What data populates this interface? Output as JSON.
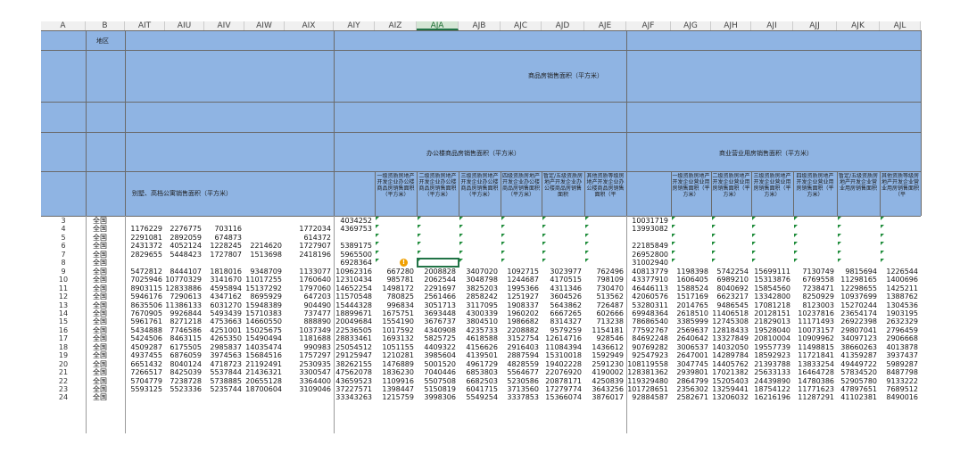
{
  "columns": [
    "A",
    "B",
    "AIT",
    "AIU",
    "AIV",
    "AIW",
    "AIX",
    "AIY",
    "AIZ",
    "AJA",
    "AJB",
    "AJC",
    "AJD",
    "AJE",
    "AJF",
    "AJG",
    "AJH",
    "AJI",
    "AJJ",
    "AJK",
    "AJL"
  ],
  "selected_column": "AJA",
  "row_labels": {
    "r1": "地区",
    "r2": "商品房销售面积（平方米）",
    "r_office": "办公楼商品房销售面积（平方米）",
    "r_commercial": "商业营业用房销售面积（平方米）",
    "r_villa": "别墅、高档公寓销售面积（平方米）"
  },
  "sub_headers_office": [
    "一级资质房地产开发企业办公楼商品房销售面积（平方米）",
    "二级资质房地产开发企业办公楼商品房销售面积（平方米）",
    "三级资质房地产开发企业办公楼商品房销售面积（平方米）",
    "四级资质房地产开发企业办公楼商品房销售面积（平方米）",
    "暂定/五级资质房地产开发企业办公楼商品房销售面积",
    "其他资质等级房地产开发企业办公楼商品房销售面积（平"
  ],
  "sub_headers_comm": [
    "一级资质房地产开发企业营业用房销售面积（平方米）",
    "二级资质房地产开发企业营业用房销售面积（平方米）",
    "三级资质房地产开发企业营业用房销售面积（平方米）",
    "四级资质房地产开发企业营业用房销售面积（平方米）",
    "暂定/五级资质房地产开发企业营业用房销售面积",
    "其他资质等级房地产开发企业营业用房销售面积（平"
  ],
  "rows": [
    {
      "n": "3",
      "b": "全国",
      "v": [
        "",
        "",
        "",
        "",
        "",
        "4034252",
        "",
        "",
        "",
        "",
        "",
        "",
        "10031719",
        "",
        "",
        "",
        "",
        "",
        ""
      ]
    },
    {
      "n": "4",
      "b": "全国",
      "v": [
        "1176229",
        "2276775",
        "703116",
        "",
        "1772034",
        "4369753",
        "",
        "",
        "",
        "",
        "",
        "",
        "13993082",
        "",
        "",
        "",
        "",
        "",
        ""
      ]
    },
    {
      "n": "5",
      "b": "全国",
      "v": [
        "2291081",
        "2892059",
        "674873",
        "",
        "614372",
        "",
        "",
        "",
        "",
        "",
        "",
        "",
        "",
        "",
        "",
        "",
        "",
        "",
        ""
      ]
    },
    {
      "n": "6",
      "b": "全国",
      "v": [
        "2431372",
        "4052124",
        "1228245",
        "2214620",
        "1727907",
        "5389175",
        "",
        "",
        "",
        "",
        "",
        "",
        "22185849",
        "",
        "",
        "",
        "",
        "",
        ""
      ]
    },
    {
      "n": "7",
      "b": "全国",
      "v": [
        "2829655",
        "5448423",
        "1727807",
        "1513698",
        "2418196",
        "5965500",
        "",
        "",
        "",
        "",
        "",
        "",
        "26952800",
        "",
        "",
        "",
        "",
        "",
        ""
      ]
    },
    {
      "n": "8",
      "b": "全国",
      "v": [
        "",
        "",
        "",
        "",
        "",
        "6928364",
        "",
        "",
        "",
        "",
        "",
        "",
        "31002940",
        "",
        "",
        "",
        "",
        "",
        ""
      ]
    },
    {
      "n": "9",
      "b": "全国",
      "v": [
        "5472812",
        "8444107",
        "1818016",
        "9348709",
        "1133077",
        "10962316",
        "667280",
        "2008828",
        "3407020",
        "1092715",
        "3023977",
        "762496",
        "40813779",
        "1198398",
        "5742254",
        "15699111",
        "7130749",
        "9815694",
        "1226544"
      ]
    },
    {
      "n": "10",
      "b": "全国",
      "v": [
        "7025946",
        "10770329",
        "3141670",
        "11017255",
        "1760640",
        "12310434",
        "985781",
        "2062544",
        "3048798",
        "1244687",
        "4170515",
        "798109",
        "43377910",
        "1606405",
        "6989210",
        "15313876",
        "6769558",
        "11298165",
        "1400696"
      ]
    },
    {
      "n": "11",
      "b": "全国",
      "v": [
        "8903115",
        "12833886",
        "4595894",
        "15137292",
        "1797060",
        "14652254",
        "1498172",
        "2291697",
        "3825203",
        "1995366",
        "4311346",
        "730470",
        "46446113",
        "1588524",
        "8040692",
        "15854560",
        "7238471",
        "12298655",
        "1425211"
      ]
    },
    {
      "n": "12",
      "b": "全国",
      "v": [
        "5946176",
        "7290613",
        "4347162",
        "8695929",
        "647203",
        "11570548",
        "780825",
        "2561466",
        "2858242",
        "1251927",
        "3604526",
        "513562",
        "42060576",
        "1517169",
        "6623217",
        "13342800",
        "8250929",
        "10937699",
        "1388762"
      ]
    },
    {
      "n": "13",
      "b": "全国",
      "v": [
        "8635506",
        "11386133",
        "6031270",
        "15948389",
        "904490",
        "15444328",
        "996834",
        "3051713",
        "3117095",
        "1908337",
        "5643862",
        "726487",
        "53280311",
        "2014765",
        "9486545",
        "17081218",
        "8123003",
        "15270244",
        "1304536"
      ]
    },
    {
      "n": "14",
      "b": "全国",
      "v": [
        "7670905",
        "9926844",
        "5493439",
        "15710383",
        "737477",
        "18899671",
        "1675751",
        "3693448",
        "4300339",
        "1960202",
        "6667265",
        "602666",
        "69948364",
        "2618510",
        "11406518",
        "20128151",
        "10237816",
        "23654174",
        "1903195"
      ]
    },
    {
      "n": "15",
      "b": "全国",
      "v": [
        "5961761",
        "8271218",
        "4753663",
        "14660550",
        "888890",
        "20049684",
        "1554190",
        "3676737",
        "3804510",
        "1986682",
        "8314327",
        "713238",
        "78686540",
        "3385999",
        "12745308",
        "21829013",
        "11171493",
        "26922398",
        "2632329"
      ]
    },
    {
      "n": "16",
      "b": "全国",
      "v": [
        "5434888",
        "7746586",
        "4251001",
        "15025675",
        "1037349",
        "22536505",
        "1017592",
        "4340908",
        "4235733",
        "2208882",
        "9579259",
        "1154181",
        "77592767",
        "2569637",
        "12818433",
        "19528040",
        "10073157",
        "29807041",
        "2796459"
      ]
    },
    {
      "n": "17",
      "b": "全国",
      "v": [
        "5424506",
        "8463115",
        "4265350",
        "15490494",
        "1181688",
        "28833461",
        "1693132",
        "5825725",
        "4618588",
        "3152754",
        "12614716",
        "928546",
        "84692248",
        "2640642",
        "13327849",
        "20810004",
        "10909962",
        "34097123",
        "2906668"
      ]
    },
    {
      "n": "18",
      "b": "全国",
      "v": [
        "4509287",
        "6175505",
        "2985837",
        "14035474",
        "990983",
        "25054512",
        "1051155",
        "4409322",
        "4156626",
        "2916403",
        "11084394",
        "1436612",
        "90769282",
        "3006537",
        "14032050",
        "19557739",
        "11498815",
        "38660263",
        "4013878"
      ]
    },
    {
      "n": "19",
      "b": "全国",
      "v": [
        "4937455",
        "6876059",
        "3974563",
        "15684516",
        "1757297",
        "29125947",
        "1210281",
        "3985604",
        "4139501",
        "2887594",
        "15310018",
        "1592949",
        "92547923",
        "2647001",
        "14289784",
        "18592923",
        "11721841",
        "41359287",
        "3937437"
      ]
    },
    {
      "n": "20",
      "b": "全国",
      "v": [
        "6651432",
        "8040124",
        "4718723",
        "21192491",
        "2530935",
        "38262155",
        "1476889",
        "5001520",
        "4961729",
        "4828559",
        "19402228",
        "2591230",
        "108119558",
        "3047745",
        "14405762",
        "21393788",
        "13833254",
        "49449722",
        "5989287"
      ]
    },
    {
      "n": "21",
      "b": "全国",
      "v": [
        "7266517",
        "8425039",
        "5537844",
        "21436321",
        "3300547",
        "47562078",
        "1836230",
        "7040446",
        "6853803",
        "5564677",
        "22076920",
        "4190002",
        "128381362",
        "2939801",
        "17021382",
        "25633133",
        "16464728",
        "57834520",
        "8487798"
      ]
    },
    {
      "n": "22",
      "b": "全国",
      "v": [
        "5704779",
        "7238728",
        "5738885",
        "20655128",
        "3364400",
        "43659523",
        "1109916",
        "5507508",
        "6682503",
        "5230586",
        "20878171",
        "4250839",
        "119329480",
        "2864799",
        "15205403",
        "24439890",
        "14780386",
        "52905780",
        "9133222"
      ]
    },
    {
      "n": "23",
      "b": "全国",
      "v": [
        "5593125",
        "5523336",
        "5235744",
        "18700604",
        "3109046",
        "37227571",
        "1398447",
        "5150819",
        "6041715",
        "3713560",
        "17279774",
        "3643256",
        "101728651",
        "2356302",
        "13259441",
        "18754122",
        "11771623",
        "47897651",
        "7689512"
      ]
    },
    {
      "n": "24",
      "b": "全国",
      "v": [
        "",
        "",
        "",
        "",
        "",
        "33343263",
        "1215759",
        "3998306",
        "5549254",
        "3337853",
        "15366074",
        "3876017",
        "92884587",
        "2582671",
        "13206032",
        "16216196",
        "11287291",
        "41102381",
        "8490016"
      ]
    }
  ],
  "colors": {
    "band": "#8fb4e3",
    "select": "#217346",
    "warn": "#f0a000"
  }
}
